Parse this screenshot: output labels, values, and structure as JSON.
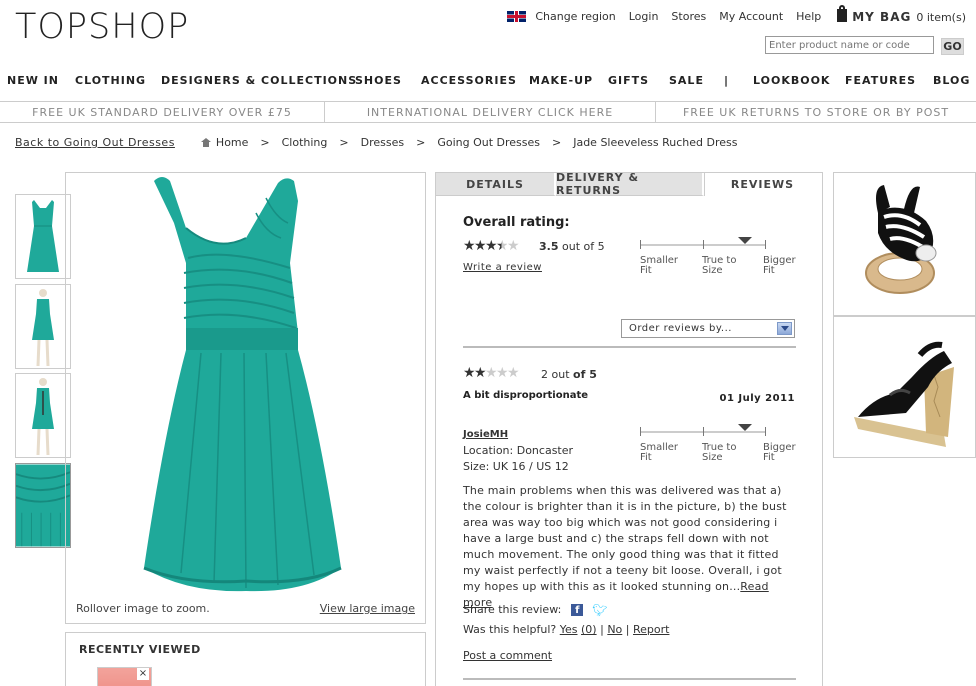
{
  "header": {
    "logo": "TOPSHOP",
    "links": [
      "Change region",
      "Login",
      "Stores",
      "My Account",
      "Help"
    ],
    "bag_label": "MY BAG",
    "bag_items": "0 item(s)",
    "search_placeholder": "Enter product name or code",
    "go_label": "GO"
  },
  "nav": [
    "NEW IN",
    "CLOTHING",
    "DESIGNERS & COLLECTIONS",
    "SHOES",
    "ACCESSORIES",
    "MAKE-UP",
    "GIFTS",
    "SALE",
    "|",
    "LOOKBOOK",
    "FEATURES",
    "BLOG"
  ],
  "promo": [
    "FREE UK STANDARD DELIVERY OVER £75",
    "INTERNATIONAL DELIVERY CLICK HERE",
    "FREE UK RETURNS TO STORE OR BY POST"
  ],
  "breadcrumb": {
    "back": "Back to Going Out Dresses",
    "items": [
      "Home",
      "Clothing",
      "Dresses",
      "Going Out Dresses",
      "Jade Sleeveless Ruched Dress"
    ],
    "sep": ">"
  },
  "product": {
    "rollover": "Rollover image to zoom.",
    "view_large": "View large image",
    "dress_color": "#1fa99a",
    "recently_viewed": "RECENTLY VIEWED",
    "close": "×"
  },
  "tabs": [
    "DETAILS",
    "DELIVERY & RETURNS",
    "REVIEWS"
  ],
  "reviews": {
    "overall_label": "Overall rating:",
    "overall_rating": 3.5,
    "overall_value": "3.5",
    "overall_suffix": "out of 5",
    "write_review": "Write a review",
    "fit_labels": [
      "Smaller Fit",
      "True to Size",
      "Bigger Fit"
    ],
    "order_by": "Order reviews by...",
    "review": {
      "rating": 2,
      "rating_value": "2",
      "rating_suffix": "out of 5",
      "title": "A bit disproportionate",
      "date": "01 July 2011",
      "user": "JosieMH",
      "location": "Location: Doncaster",
      "size": "Size: UK 16 / US 12",
      "body": "The main problems when this was delivered was that a) the colour is brighter than it is in the picture, b) the bust area was way too big which was not good considering i have a large bust and c) the straps fell down with not much movement. The only good thing was that it fitted my waist perfectly if not a teeny bit loose. Overall, i got my hopes up with this as it looked stunning on...",
      "read_more": "Read more",
      "share": "Share this review:",
      "helpful": "Was this helpful?",
      "yes": "Yes",
      "yes_count": "(0)",
      "no": "No",
      "report": "Report",
      "post_comment": "Post a comment"
    }
  }
}
